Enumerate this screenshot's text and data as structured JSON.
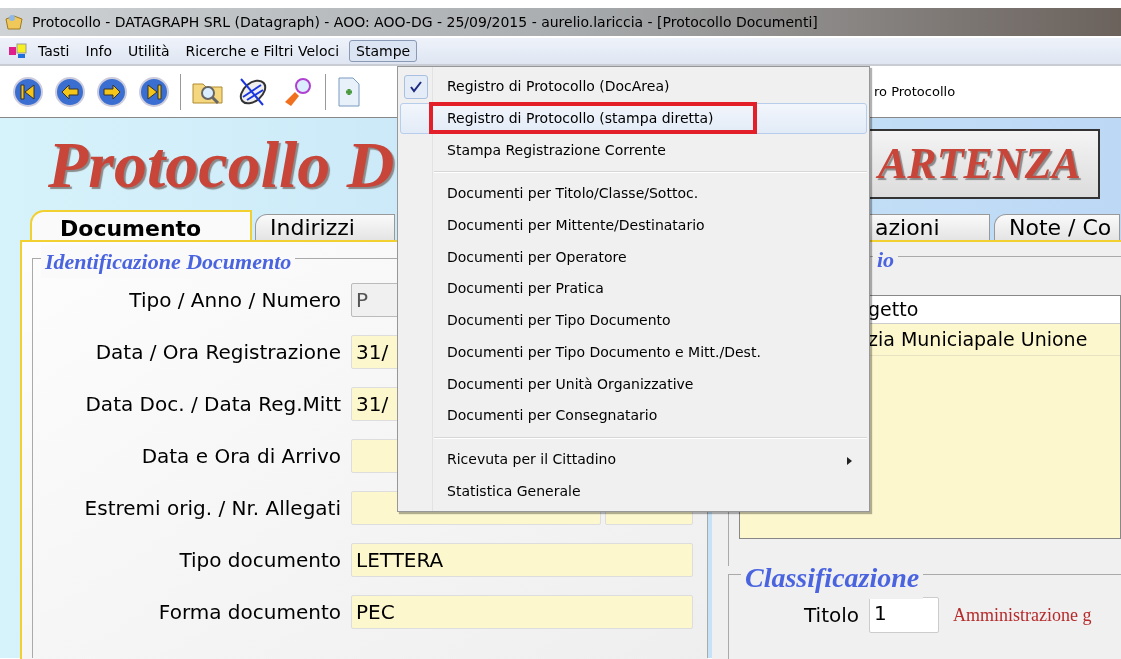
{
  "window": {
    "title": "Protocollo - DATAGRAPH SRL (Datagraph) - AOO: AOO-DG - 25/09/2015 - aurelio.lariccia - [Protocollo Documenti]"
  },
  "menu_bar": [
    {
      "label": "Tasti",
      "selected": false
    },
    {
      "label": "Info",
      "selected": false
    },
    {
      "label": "Utilità",
      "selected": false
    },
    {
      "label": "Ricerche e Filtri Veloci",
      "selected": false
    },
    {
      "label": "Stampe",
      "selected": true
    }
  ],
  "toolbar": {
    "status_text": "ro Protocollo"
  },
  "dropdown": {
    "items": [
      {
        "kind": "item",
        "label": "Registro di Protocollo (DocArea)",
        "checked": true,
        "selected": false,
        "framed": false,
        "submenu": false
      },
      {
        "kind": "item",
        "label": "Registro di Protocollo (stampa diretta)",
        "checked": false,
        "selected": true,
        "framed": true,
        "submenu": false
      },
      {
        "kind": "item",
        "label": "Stampa Registrazione Corrente",
        "checked": false,
        "selected": false,
        "framed": false,
        "submenu": false
      },
      {
        "kind": "separator"
      },
      {
        "kind": "item",
        "label": "Documenti per Titolo/Classe/Sottoc.",
        "checked": false,
        "selected": false,
        "framed": false,
        "submenu": false
      },
      {
        "kind": "item",
        "label": "Documenti per Mittente/Destinatario",
        "checked": false,
        "selected": false,
        "framed": false,
        "submenu": false
      },
      {
        "kind": "item",
        "label": "Documenti per Operatore",
        "checked": false,
        "selected": false,
        "framed": false,
        "submenu": false
      },
      {
        "kind": "item",
        "label": "Documenti per Pratica",
        "checked": false,
        "selected": false,
        "framed": false,
        "submenu": false
      },
      {
        "kind": "item",
        "label": "Documenti per Tipo Documento",
        "checked": false,
        "selected": false,
        "framed": false,
        "submenu": false
      },
      {
        "kind": "item",
        "label": "Documenti per Tipo Documento e Mitt./Dest.",
        "checked": false,
        "selected": false,
        "framed": false,
        "submenu": false
      },
      {
        "kind": "item",
        "label": "Documenti per Unità Organizzative",
        "checked": false,
        "selected": false,
        "framed": false,
        "submenu": false
      },
      {
        "kind": "item",
        "label": "Documenti per Consegnatario",
        "checked": false,
        "selected": false,
        "framed": false,
        "submenu": false
      },
      {
        "kind": "separator"
      },
      {
        "kind": "item",
        "label": "Ricevuta per il Cittadino",
        "checked": false,
        "selected": false,
        "framed": false,
        "submenu": true
      },
      {
        "kind": "item",
        "label": "Statistica Generale",
        "checked": false,
        "selected": false,
        "framed": false,
        "submenu": false
      }
    ]
  },
  "heading": {
    "title": "Protocollo D",
    "direction_button": "ARTENZA"
  },
  "tabs": [
    {
      "label": "Documento",
      "selected": true
    },
    {
      "label": "Indirizzi",
      "selected": false
    },
    {
      "label": "azioni",
      "selected": false
    },
    {
      "label": "Note / Co",
      "selected": false
    }
  ],
  "identification": {
    "title": "Identificazione Documento",
    "rows": [
      {
        "label": "Tipo / Anno / Numero",
        "fields": [
          {
            "value": "P",
            "disabled": true
          }
        ]
      },
      {
        "label": "Data / Ora Registrazione",
        "fields": [
          {
            "value": "31/",
            "disabled": false
          }
        ]
      },
      {
        "label": "Data Doc. / Data Reg.Mitt",
        "fields": [
          {
            "value": "31/",
            "disabled": false
          }
        ]
      },
      {
        "label": "Data e Ora di Arrivo",
        "fields": [
          {
            "disabled": false
          }
        ]
      },
      {
        "label": "Estremi orig. / Nr. Allegati",
        "fields": [
          {
            "disabled": false
          },
          {
            "disabled": false
          }
        ]
      },
      {
        "label": "Tipo documento",
        "fields": [
          {
            "value": "LETTERA",
            "disabled": false
          }
        ]
      },
      {
        "label": "Forma documento",
        "fields": [
          {
            "value": "PEC",
            "disabled": false
          }
        ]
      }
    ]
  },
  "right_group": {
    "title": "io",
    "table": {
      "header": "getto",
      "rows": [
        "zia Municiapale Unione"
      ]
    }
  },
  "classification": {
    "title": "Classificazione",
    "rows": [
      {
        "label": "Titolo",
        "code": "1",
        "description": "Amministrazione g"
      }
    ]
  }
}
